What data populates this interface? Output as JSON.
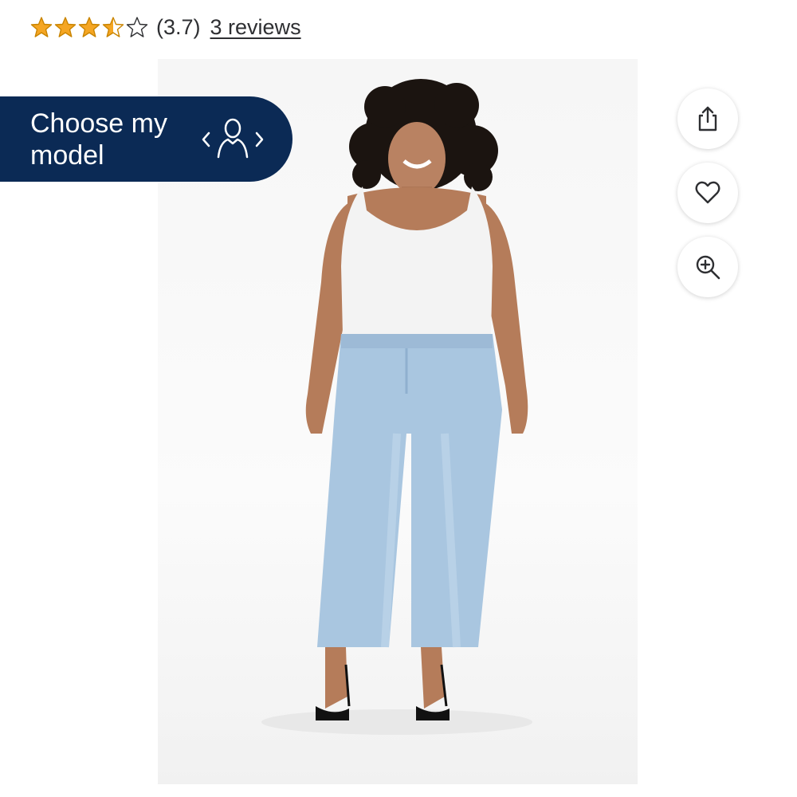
{
  "rating": {
    "stars": 3.5,
    "star_color": "#f5a623",
    "value_text": "(3.7)",
    "reviews_text": "3 reviews"
  },
  "model_selector": {
    "label": "Choose my\nmodel",
    "icon": "person-switch-icon",
    "background": "#0b2a55"
  },
  "actions": [
    {
      "name": "share",
      "icon": "share-icon"
    },
    {
      "name": "favorite",
      "icon": "heart-icon"
    },
    {
      "name": "zoom",
      "icon": "zoom-in-icon"
    }
  ],
  "product_image": {
    "subject": "model-wearing-light-wash-jeans"
  }
}
